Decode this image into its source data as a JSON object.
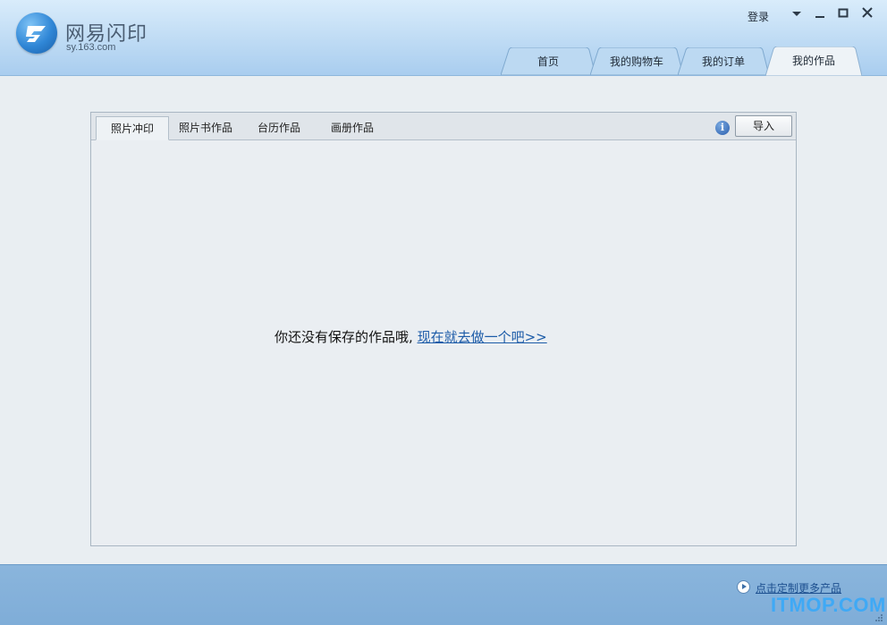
{
  "app": {
    "name": "网易闪印",
    "url": "sy.163.com"
  },
  "header": {
    "login_label": "登录",
    "tabs": [
      {
        "label": "首页"
      },
      {
        "label": "我的购物车"
      },
      {
        "label": "我的订单"
      },
      {
        "label": "我的作品",
        "active": true
      }
    ]
  },
  "works": {
    "subtabs": [
      {
        "label": "照片冲印",
        "active": true
      },
      {
        "label": "照片书作品"
      },
      {
        "label": "台历作品"
      },
      {
        "label": "画册作品"
      }
    ],
    "import_label": "导入",
    "info_icon": "info-icon",
    "empty_text": "你还没有保存的作品哦,",
    "create_link": "现在就去做一个吧>>"
  },
  "footer": {
    "more_link": "点击定制更多产品",
    "watermark": "ITMOP.COM"
  },
  "colors": {
    "header": "#c3def5",
    "footer": "#84b1da",
    "link": "#1c5ba8",
    "watermark": "#3fa9f5"
  }
}
